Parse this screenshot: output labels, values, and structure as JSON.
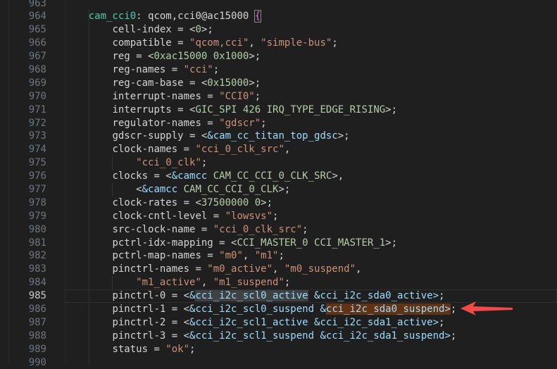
{
  "colors": {
    "background": "#1f1f1f",
    "text": "#d4d4d4",
    "string": "#ce9178",
    "number": "#b5cea8",
    "reference": "#9cdcfe",
    "label": "#4ec9b0",
    "arrow": "#f24a46"
  },
  "current_line": 985,
  "annotation": {
    "icon": "red-arrow-icon",
    "points_to_line": 986
  },
  "lines": [
    {
      "n": "963",
      "indent": 0,
      "tokens": []
    },
    {
      "n": "964",
      "indent": 4,
      "tokens": [
        [
          "l",
          "cam_cci0"
        ],
        [
          "d",
          ": qcom,cci0@ac15000 "
        ],
        [
          "b",
          "{"
        ]
      ]
    },
    {
      "n": "965",
      "indent": 8,
      "tokens": [
        [
          "d",
          "cell-index = <"
        ],
        [
          "n",
          "0"
        ],
        [
          "d",
          ">;"
        ]
      ]
    },
    {
      "n": "966",
      "indent": 8,
      "tokens": [
        [
          "d",
          "compatible = "
        ],
        [
          "s",
          "\"qcom,cci\""
        ],
        [
          "d",
          ", "
        ],
        [
          "s",
          "\"simple-bus\""
        ],
        [
          "d",
          ";"
        ]
      ]
    },
    {
      "n": "967",
      "indent": 8,
      "tokens": [
        [
          "d",
          "reg = <"
        ],
        [
          "n",
          "0xac15000 0x1000"
        ],
        [
          "d",
          ">;"
        ]
      ]
    },
    {
      "n": "968",
      "indent": 8,
      "tokens": [
        [
          "d",
          "reg-names = "
        ],
        [
          "s",
          "\"cci\""
        ],
        [
          "d",
          ";"
        ]
      ]
    },
    {
      "n": "969",
      "indent": 8,
      "tokens": [
        [
          "d",
          "reg-cam-base = <"
        ],
        [
          "n",
          "0x15000"
        ],
        [
          "d",
          ">;"
        ]
      ]
    },
    {
      "n": "970",
      "indent": 8,
      "tokens": [
        [
          "d",
          "interrupt-names = "
        ],
        [
          "s",
          "\"CCI0\""
        ],
        [
          "d",
          ";"
        ]
      ]
    },
    {
      "n": "971",
      "indent": 8,
      "tokens": [
        [
          "d",
          "interrupts = <"
        ],
        [
          "n",
          "GIC_SPI 426 IRQ_TYPE_EDGE_RISING"
        ],
        [
          "d",
          ">;"
        ]
      ]
    },
    {
      "n": "972",
      "indent": 8,
      "tokens": [
        [
          "d",
          "regulator-names = "
        ],
        [
          "s",
          "\"gdscr\""
        ],
        [
          "d",
          ";"
        ]
      ]
    },
    {
      "n": "973",
      "indent": 8,
      "tokens": [
        [
          "d",
          "gdscr-supply = <"
        ],
        [
          "r",
          "&cam_cc_titan_top_gdsc"
        ],
        [
          "d",
          ">;"
        ]
      ]
    },
    {
      "n": "974",
      "indent": 8,
      "tokens": [
        [
          "d",
          "clock-names = "
        ],
        [
          "s",
          "\"cci_0_clk_src\""
        ],
        [
          "d",
          ","
        ]
      ]
    },
    {
      "n": "975",
      "indent": 12,
      "tokens": [
        [
          "s",
          "\"cci_0_clk\""
        ],
        [
          "d",
          ";"
        ]
      ]
    },
    {
      "n": "976",
      "indent": 8,
      "tokens": [
        [
          "d",
          "clocks = <"
        ],
        [
          "r",
          "&camcc"
        ],
        [
          "d",
          " "
        ],
        [
          "n",
          "CAM_CC_CCI_0_CLK_SRC"
        ],
        [
          "d",
          ">,"
        ]
      ]
    },
    {
      "n": "977",
      "indent": 12,
      "tokens": [
        [
          "d",
          "<"
        ],
        [
          "r",
          "&camcc"
        ],
        [
          "d",
          " "
        ],
        [
          "n",
          "CAM_CC_CCI_0_CLK"
        ],
        [
          "d",
          ">;"
        ]
      ]
    },
    {
      "n": "978",
      "indent": 8,
      "tokens": [
        [
          "d",
          "clock-rates = <"
        ],
        [
          "n",
          "37500000 0"
        ],
        [
          "d",
          ">;"
        ]
      ]
    },
    {
      "n": "979",
      "indent": 8,
      "tokens": [
        [
          "d",
          "clock-cntl-level = "
        ],
        [
          "s",
          "\"lowsvs\""
        ],
        [
          "d",
          ";"
        ]
      ]
    },
    {
      "n": "980",
      "indent": 8,
      "tokens": [
        [
          "d",
          "src-clock-name = "
        ],
        [
          "s",
          "\"cci_0_clk_src\""
        ],
        [
          "d",
          ";"
        ]
      ]
    },
    {
      "n": "981",
      "indent": 8,
      "tokens": [
        [
          "d",
          "pctrl-idx-mapping = <"
        ],
        [
          "n",
          "CCI_MASTER_0 CCI_MASTER_1"
        ],
        [
          "d",
          ">;"
        ]
      ]
    },
    {
      "n": "982",
      "indent": 8,
      "tokens": [
        [
          "d",
          "pctrl-map-names = "
        ],
        [
          "s",
          "\"m0\""
        ],
        [
          "d",
          ", "
        ],
        [
          "s",
          "\"m1\""
        ],
        [
          "d",
          ";"
        ]
      ]
    },
    {
      "n": "983",
      "indent": 8,
      "tokens": [
        [
          "d",
          "pinctrl-names = "
        ],
        [
          "s",
          "\"m0_active\""
        ],
        [
          "d",
          ", "
        ],
        [
          "s",
          "\"m0_suspend\""
        ],
        [
          "d",
          ","
        ]
      ]
    },
    {
      "n": "984",
      "indent": 12,
      "tokens": [
        [
          "s",
          "\"m1_active\""
        ],
        [
          "d",
          ", "
        ],
        [
          "s",
          "\"m1_suspend\""
        ],
        [
          "d",
          ";"
        ]
      ]
    },
    {
      "n": "985",
      "indent": 8,
      "tokens": [
        [
          "d",
          "pinctrl-0 = <"
        ],
        [
          "r",
          "&"
        ],
        [
          "rw",
          "cci_i2c_scl0_active"
        ],
        [
          "r",
          " &cci_i2c_sda0_active>"
        ],
        [
          "d",
          ";"
        ]
      ]
    },
    {
      "n": "986",
      "indent": 8,
      "tokens": [
        [
          "d",
          "pinctrl-1 = <"
        ],
        [
          "r",
          "&cci_i2c_scl0_suspend &"
        ],
        [
          "rm",
          "cci_i2c_sda0_suspend>"
        ],
        [
          "d",
          ";"
        ]
      ]
    },
    {
      "n": "987",
      "indent": 8,
      "tokens": [
        [
          "d",
          "pinctrl-2 = <"
        ],
        [
          "r",
          "&cci_i2c_scl1_active &cci_i2c_sda1_active>"
        ],
        [
          "d",
          ";"
        ]
      ]
    },
    {
      "n": "988",
      "indent": 8,
      "tokens": [
        [
          "d",
          "pinctrl-3 = <"
        ],
        [
          "r",
          "&cci_i2c_scl1_suspend &cci_i2c_sda1_suspend>"
        ],
        [
          "d",
          ";"
        ]
      ]
    },
    {
      "n": "989",
      "indent": 8,
      "tokens": [
        [
          "d",
          "status = "
        ],
        [
          "s",
          "\"ok\""
        ],
        [
          "d",
          ";"
        ]
      ]
    },
    {
      "n": "990",
      "indent": 0,
      "tokens": []
    }
  ]
}
